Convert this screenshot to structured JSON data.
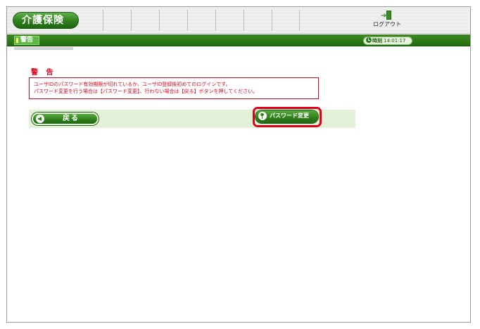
{
  "header": {
    "app_title": "介護保険",
    "logout_label": "ログアウト"
  },
  "bar": {
    "page_tab": "警告",
    "clock_label": "時刻",
    "clock_time": "14:01:17"
  },
  "content": {
    "warning_title": "警 告",
    "message_line1": "ユーザIDのパスワード有効期限が切れているか、ユーザID登録後初めてのログインです。",
    "message_line2": "パスワード変更を行う場合は【パスワード変更】、行わない場合は【戻る】ボタンを押してください。"
  },
  "buttons": {
    "back_label": "戻る",
    "password_change_label": "パスワード変更"
  },
  "colors": {
    "brand_green": "#2f7f1d",
    "warning_red": "#e2001a",
    "action_bg": "#e3f1d8"
  }
}
